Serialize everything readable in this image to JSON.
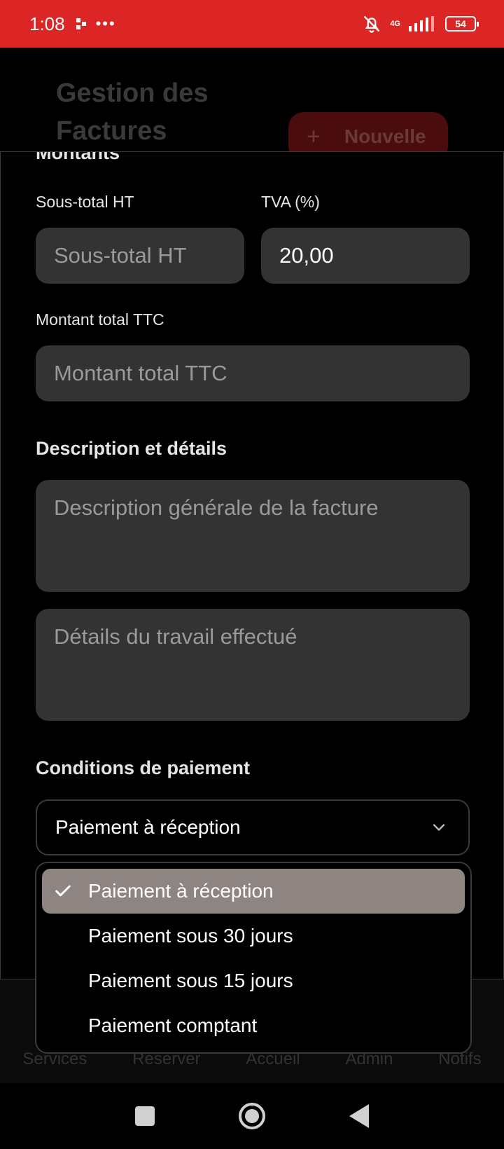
{
  "status_bar": {
    "time": "1:08",
    "extra": "•••",
    "network": "4G",
    "battery": "54"
  },
  "background": {
    "title": "Gestion des Factures",
    "new_button_label": "Nouvelle",
    "nav_labels": [
      "Services",
      "Réserver",
      "Accueil",
      "Admin",
      "Notifs"
    ]
  },
  "form": {
    "amounts_section_title": "Montants",
    "subtotal_label": "Sous-total HT",
    "subtotal_placeholder": "Sous-total HT",
    "tva_label": "TVA (%)",
    "tva_value": "20,00",
    "total_label": "Montant total TTC",
    "total_placeholder": "Montant total TTC",
    "description_section_title": "Description et détails",
    "description_placeholder": "Description générale de la facture",
    "details_placeholder": "Détails du travail effectué",
    "payment_section_title": "Conditions de paiement",
    "payment_selected": "Paiement à réception"
  },
  "dropdown": {
    "options": [
      {
        "label": "Paiement à réception",
        "selected": true
      },
      {
        "label": "Paiement sous 30 jours",
        "selected": false
      },
      {
        "label": "Paiement sous 15 jours",
        "selected": false
      },
      {
        "label": "Paiement comptant",
        "selected": false
      }
    ]
  },
  "colors": {
    "status_bar": "#dc2626",
    "input_bg": "#333333",
    "selected_option_bg": "#8e8583"
  }
}
